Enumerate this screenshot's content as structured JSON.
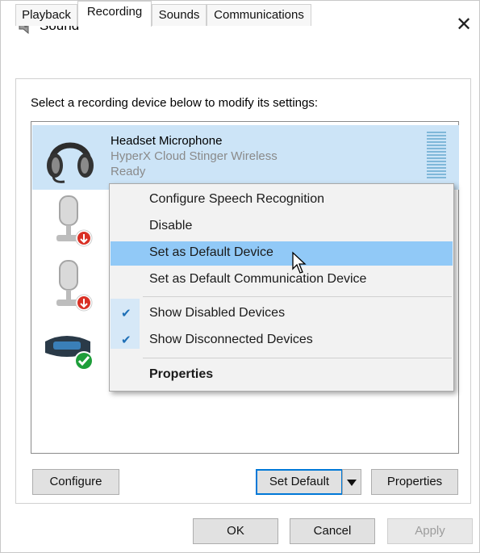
{
  "window": {
    "title": "Sound",
    "close_glyph": "✕"
  },
  "tabs": [
    {
      "label": "Playback",
      "active": false
    },
    {
      "label": "Recording",
      "active": true
    },
    {
      "label": "Sounds",
      "active": false
    },
    {
      "label": "Communications",
      "active": false
    }
  ],
  "instruction": "Select a recording device below to modify its settings:",
  "devices": [
    {
      "name": "Headset Microphone",
      "description": "HyperX Cloud Stinger Wireless",
      "status": "Ready",
      "icon": "headset-icon",
      "selected": true
    },
    {
      "name": "",
      "icon": "microphone-icon",
      "status_badge": "disabled-arrow-badge"
    },
    {
      "name": "",
      "icon": "microphone-icon",
      "status_badge": "disabled-arrow-badge"
    },
    {
      "name": "",
      "icon": "webcam-icon",
      "status_badge": "default-check-badge"
    }
  ],
  "context_menu": {
    "items": [
      {
        "label": "Configure Speech Recognition",
        "checked": false,
        "highlighted": false
      },
      {
        "label": "Disable",
        "checked": false,
        "highlighted": false
      },
      {
        "label": "Set as Default Device",
        "checked": false,
        "highlighted": true
      },
      {
        "label": "Set as Default Communication Device",
        "checked": false,
        "highlighted": false
      },
      {
        "label": "Show Disabled Devices",
        "checked": true,
        "highlighted": false
      },
      {
        "label": "Show Disconnected Devices",
        "checked": true,
        "highlighted": false
      },
      {
        "label": "Properties",
        "checked": false,
        "highlighted": false,
        "bold": true
      }
    ]
  },
  "buttons": {
    "configure": "Configure",
    "set_default": "Set Default",
    "properties": "Properties",
    "ok": "OK",
    "cancel": "Cancel",
    "apply": "Apply"
  },
  "colors": {
    "selection": "#cce4f7",
    "menu_highlight": "#91c9f7",
    "check": "#1e6fb6",
    "badge_red": "#d93025",
    "badge_green": "#1e9e3a"
  }
}
